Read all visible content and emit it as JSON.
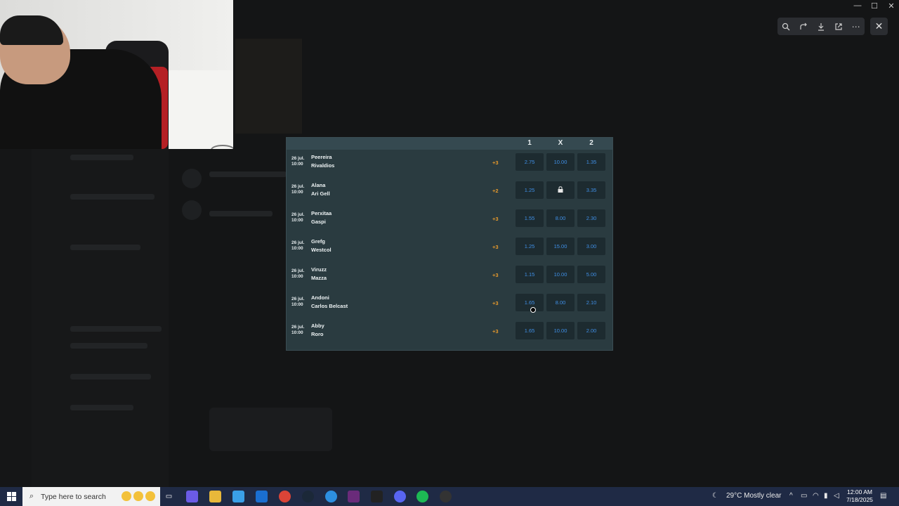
{
  "viewer": {
    "toolbar": [
      "zoom-icon",
      "rotate-icon",
      "download-icon",
      "open-external-icon",
      "more-icon"
    ],
    "close_icon": "close-icon"
  },
  "window_controls": [
    "minimize",
    "maximize",
    "close"
  ],
  "bets": {
    "columns": [
      "1",
      "X",
      "2"
    ],
    "rows": [
      {
        "date": "26 jul.",
        "time": "10:00",
        "team1": "Peereira",
        "team2": "Rivaldios",
        "more": "+3",
        "o1": "2.75",
        "ox": "10.00",
        "o2": "1.35"
      },
      {
        "date": "26 jul.",
        "time": "10:00",
        "team1": "Alana",
        "team2": "Ari Gell",
        "more": "+2",
        "o1": "1.25",
        "ox": "locked",
        "o2": "3.35"
      },
      {
        "date": "26 jul.",
        "time": "10:00",
        "team1": "Perxitaa",
        "team2": "Gaspi",
        "more": "+3",
        "o1": "1.55",
        "ox": "8.00",
        "o2": "2.30"
      },
      {
        "date": "26 jul.",
        "time": "10:00",
        "team1": "Grefg",
        "team2": "Westcol",
        "more": "+3",
        "o1": "1.25",
        "ox": "15.00",
        "o2": "3.00"
      },
      {
        "date": "26 jul.",
        "time": "10:00",
        "team1": "Viruzz",
        "team2": "Mazza",
        "more": "+3",
        "o1": "1.15",
        "ox": "10.00",
        "o2": "5.00"
      },
      {
        "date": "26 jul.",
        "time": "10:00",
        "team1": "Andoni",
        "team2": "Carlos Belcast",
        "more": "+3",
        "o1": "1.65",
        "ox": "8.00",
        "o2": "2.10"
      },
      {
        "date": "26 jul.",
        "time": "10:00",
        "team1": "Abby",
        "team2": "Roro",
        "more": "+3",
        "o1": "1.65",
        "ox": "10.00",
        "o2": "2.00"
      }
    ]
  },
  "taskbar": {
    "search_placeholder": "Type here to search",
    "weather": "29°C  Mostly clear",
    "time": "12:00 AM",
    "date": "7/18/2025",
    "apps": [
      "task-view",
      "copilot",
      "file-explorer",
      "store",
      "outlook",
      "chrome",
      "steam",
      "edge",
      "visual-studio",
      "epic-games",
      "discord",
      "spotify",
      "obs"
    ]
  },
  "colors": {
    "panel_bg": "#2a3b40",
    "odd_bg": "#1d2b30",
    "odd_text": "#3f8fe6",
    "more_text": "#e79a2c",
    "taskbar": "#1f2a45"
  }
}
